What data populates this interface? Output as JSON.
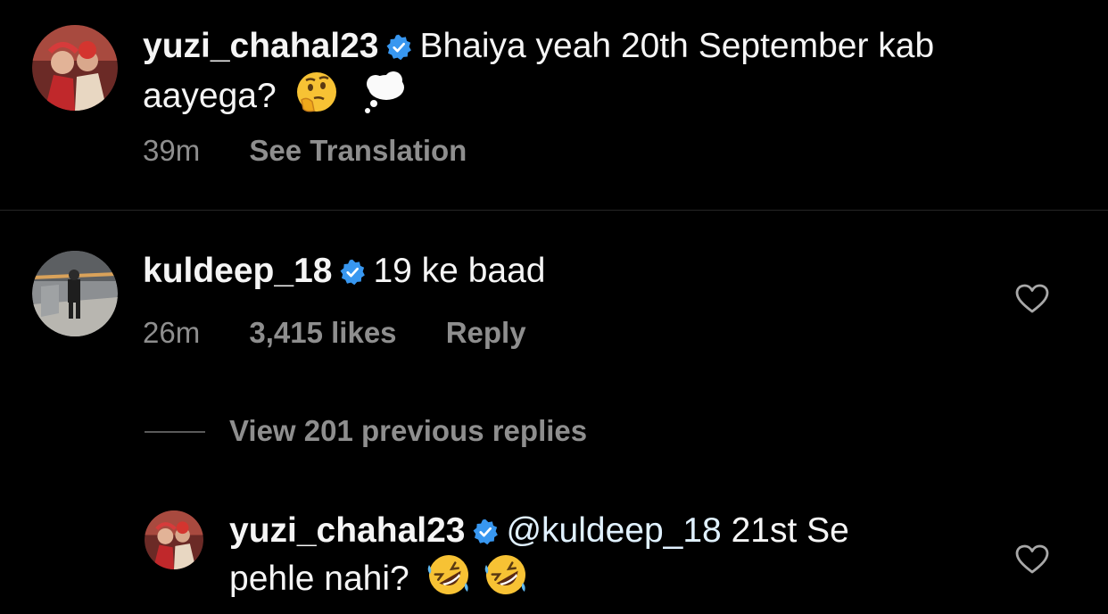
{
  "comments": [
    {
      "username": "yuzi_chahal23",
      "text_line1": "Bhaiya yeah 20th September kab",
      "text_line2": "aayega?",
      "time": "39m",
      "action": "See Translation",
      "emojis": [
        "thinking-face",
        "thought-balloon"
      ]
    },
    {
      "username": "kuldeep_18",
      "text": "19 ke baad",
      "time": "26m",
      "likes": "3,415 likes",
      "action": "Reply"
    }
  ],
  "view_replies": "View 201 previous replies",
  "reply": {
    "username": "yuzi_chahal23",
    "mention": "@kuldeep_18",
    "text_line1": "21st Se",
    "text_line2": "pehle nahi?",
    "emojis": [
      "rolling-on-floor-laughing",
      "rolling-on-floor-laughing"
    ]
  },
  "colors": {
    "background": "#000000",
    "text": "#f5f5f5",
    "meta": "#8e8e8e",
    "verified": "#3897f0",
    "mention": "#e0f1ff"
  }
}
